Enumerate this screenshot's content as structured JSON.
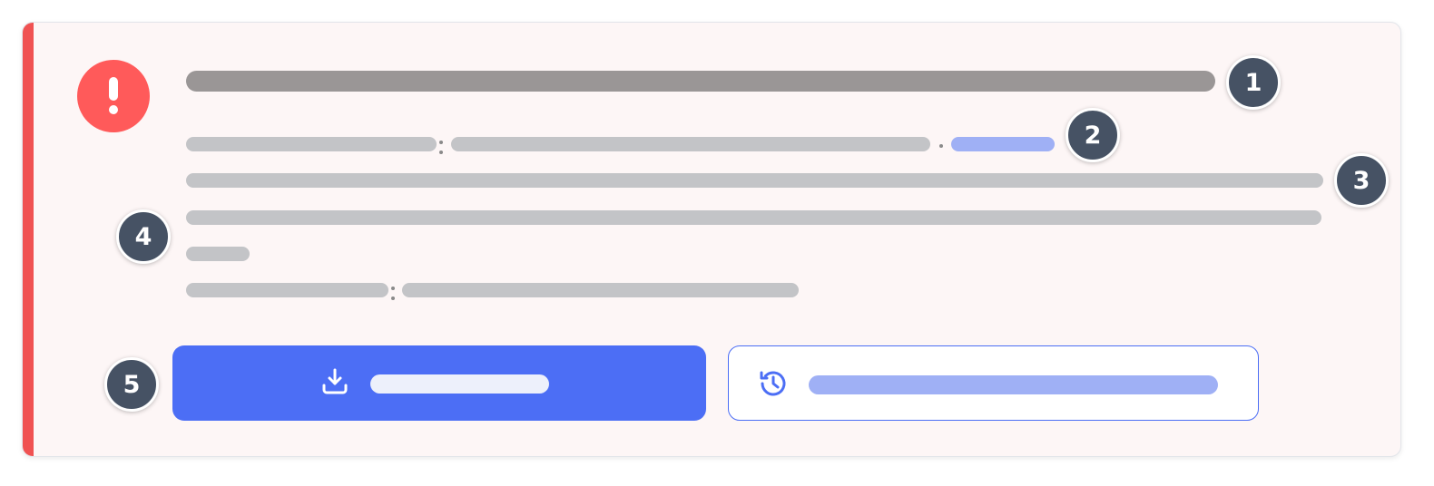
{
  "colors": {
    "accent": "#f05252",
    "alert_icon": "#ff5a5a",
    "primary": "#4c6ef5",
    "badge": "#465264",
    "title_placeholder": "#9a9696",
    "text_placeholder": "#c3c4c7",
    "link_placeholder": "#9fb0f5",
    "card_background": "#fdf6f6"
  },
  "alert": {
    "icon": "exclamation-icon"
  },
  "annotations": {
    "badge_1": "1",
    "badge_2": "2",
    "badge_3": "3",
    "badge_4": "4",
    "badge_5": "5"
  },
  "actions": {
    "primary": {
      "icon": "download-icon",
      "style": "filled"
    },
    "secondary": {
      "icon": "history-icon",
      "style": "outline"
    }
  }
}
